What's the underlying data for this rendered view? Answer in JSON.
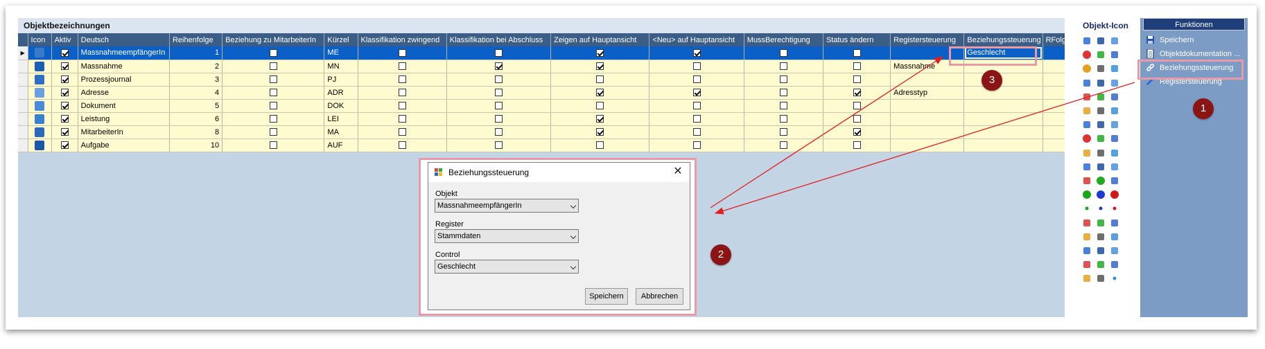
{
  "main": {
    "title": "Objektbezeichnungen",
    "columns": [
      "Icon",
      "Aktiv",
      "Deutsch",
      "Reihenfolge",
      "Beziehung zu MitarbeiterIn",
      "Kürzel",
      "Klassifikation zwingend",
      "Klassifikation bei Abschluss",
      "Zeigen auf Hauptansicht",
      "<Neu> auf Hauptansicht",
      "MussBerechtigung",
      "Status ändern",
      "Registersteuerung",
      "Beziehungssteuerung",
      "RFolge Be"
    ],
    "rows": [
      {
        "aktiv": true,
        "deutsch": "MassnahmeempfängerIn",
        "reihenfolge": "1",
        "beziehung": false,
        "kuerzel": "ME",
        "klass_zw": false,
        "klass_ab": false,
        "zeigen": true,
        "neu": true,
        "muss": false,
        "status": false,
        "register": "",
        "beziehungssteuerung": "Geschlecht",
        "selected": true,
        "icon_color": "#3a78c8"
      },
      {
        "aktiv": true,
        "deutsch": "Massnahme",
        "reihenfolge": "2",
        "beziehung": false,
        "kuerzel": "MN",
        "klass_zw": false,
        "klass_ab": true,
        "zeigen": true,
        "neu": false,
        "muss": false,
        "status": false,
        "register": "Massnahme",
        "beziehungssteuerung": "",
        "selected": false,
        "icon_color": "#1a5fb4"
      },
      {
        "aktiv": true,
        "deutsch": "Prozessjournal",
        "reihenfolge": "3",
        "beziehung": false,
        "kuerzel": "PJ",
        "klass_zw": false,
        "klass_ab": false,
        "zeigen": false,
        "neu": false,
        "muss": false,
        "status": false,
        "register": "",
        "beziehungssteuerung": "",
        "selected": false,
        "icon_color": "#2d6fc2"
      },
      {
        "aktiv": true,
        "deutsch": "Adresse",
        "reihenfolge": "4",
        "beziehung": false,
        "kuerzel": "ADR",
        "klass_zw": false,
        "klass_ab": false,
        "zeigen": true,
        "neu": true,
        "muss": false,
        "status": true,
        "register": "Adresstyp",
        "beziehungssteuerung": "",
        "selected": false,
        "icon_color": "#6aa0e0"
      },
      {
        "aktiv": true,
        "deutsch": "Dokument",
        "reihenfolge": "5",
        "beziehung": false,
        "kuerzel": "DOK",
        "klass_zw": false,
        "klass_ab": false,
        "zeigen": false,
        "neu": false,
        "muss": false,
        "status": false,
        "register": "",
        "beziehungssteuerung": "",
        "selected": false,
        "icon_color": "#4a88d8"
      },
      {
        "aktiv": true,
        "deutsch": "Leistung",
        "reihenfolge": "6",
        "beziehung": false,
        "kuerzel": "LEI",
        "klass_zw": false,
        "klass_ab": false,
        "zeigen": true,
        "neu": false,
        "muss": false,
        "status": false,
        "register": "",
        "beziehungssteuerung": "",
        "selected": false,
        "icon_color": "#3a80d0"
      },
      {
        "aktiv": true,
        "deutsch": "MitarbeiterIn",
        "reihenfolge": "8",
        "beziehung": false,
        "kuerzel": "MA",
        "klass_zw": false,
        "klass_ab": false,
        "zeigen": true,
        "neu": false,
        "muss": false,
        "status": true,
        "register": "",
        "beziehungssteuerung": "",
        "selected": false,
        "icon_color": "#2a68b8"
      },
      {
        "aktiv": true,
        "deutsch": "Aufgabe",
        "reihenfolge": "10",
        "beziehung": false,
        "kuerzel": "AUF",
        "klass_zw": false,
        "klass_ab": false,
        "zeigen": false,
        "neu": false,
        "muss": false,
        "status": false,
        "register": "",
        "beziehungssteuerung": "",
        "selected": false,
        "icon_color": "#1a58a8"
      }
    ]
  },
  "icon_panel": {
    "title": "Objekt-Icon",
    "icons": [
      "person-icon",
      "pencil-icon",
      "trash-icon",
      "target-icon",
      "box-icon",
      "box-icon",
      "dots-icon",
      "network-icon",
      "lifebuoy-icon",
      "user-icon",
      "cogs-icon",
      "pin-icon",
      "pencil-icon",
      "link-icon",
      "magnifier-icon",
      "pin-icon",
      "excel-icon",
      "magnifier-icon",
      "document-icon",
      "pencil-icon",
      "mail-icon",
      "globe-icon",
      "pencil-icon",
      "people-icon",
      "people-icon",
      "window-icon",
      "people-icon",
      "people-icon",
      "person-icon",
      "people-icon",
      "people-icon",
      "globe-icon",
      "people-icon",
      "green-circle-icon",
      "blue-circle-icon",
      "red-circle-icon",
      "green-dot-icon",
      "blue-dot-icon",
      "red-dot-icon",
      "clipboard-icon",
      "tools-icon",
      "people-icon",
      "gear-icon",
      "people-icon",
      "bar-icon",
      "tag-icon",
      "tag-icon",
      "book-icon",
      "people-icon",
      "people-icon",
      "window-icon",
      "pin-icon",
      "hand-icon",
      "dot-icon"
    ]
  },
  "functions": {
    "title": "Funktionen",
    "items": [
      {
        "label": "Speichern",
        "icon": "save-icon"
      },
      {
        "label": "Objektdokumentation ...",
        "icon": "document-icon"
      },
      {
        "label": "Beziehungssteuerung",
        "icon": "link-icon"
      },
      {
        "label": "Registersteuerung",
        "icon": "pencil-icon"
      }
    ]
  },
  "dialog": {
    "title": "Beziehungssteuerung",
    "close": "✕",
    "objekt_label": "Objekt",
    "objekt_value": "MassnahmeempfängerIn",
    "register_label": "Register",
    "register_value": "Stammdaten",
    "control_label": "Control",
    "control_value": "Geschlecht",
    "save_label": "Speichern",
    "cancel_label": "Abbrechen"
  },
  "markers": {
    "m1": "1",
    "m2": "2",
    "m3": "3"
  },
  "colors": {
    "header": "#3b5d86",
    "row": "#fffbd0",
    "selected": "#0a60c6",
    "marker": "#8b1515",
    "highlight": "#ea9aa6",
    "arrow": "#e02020"
  }
}
